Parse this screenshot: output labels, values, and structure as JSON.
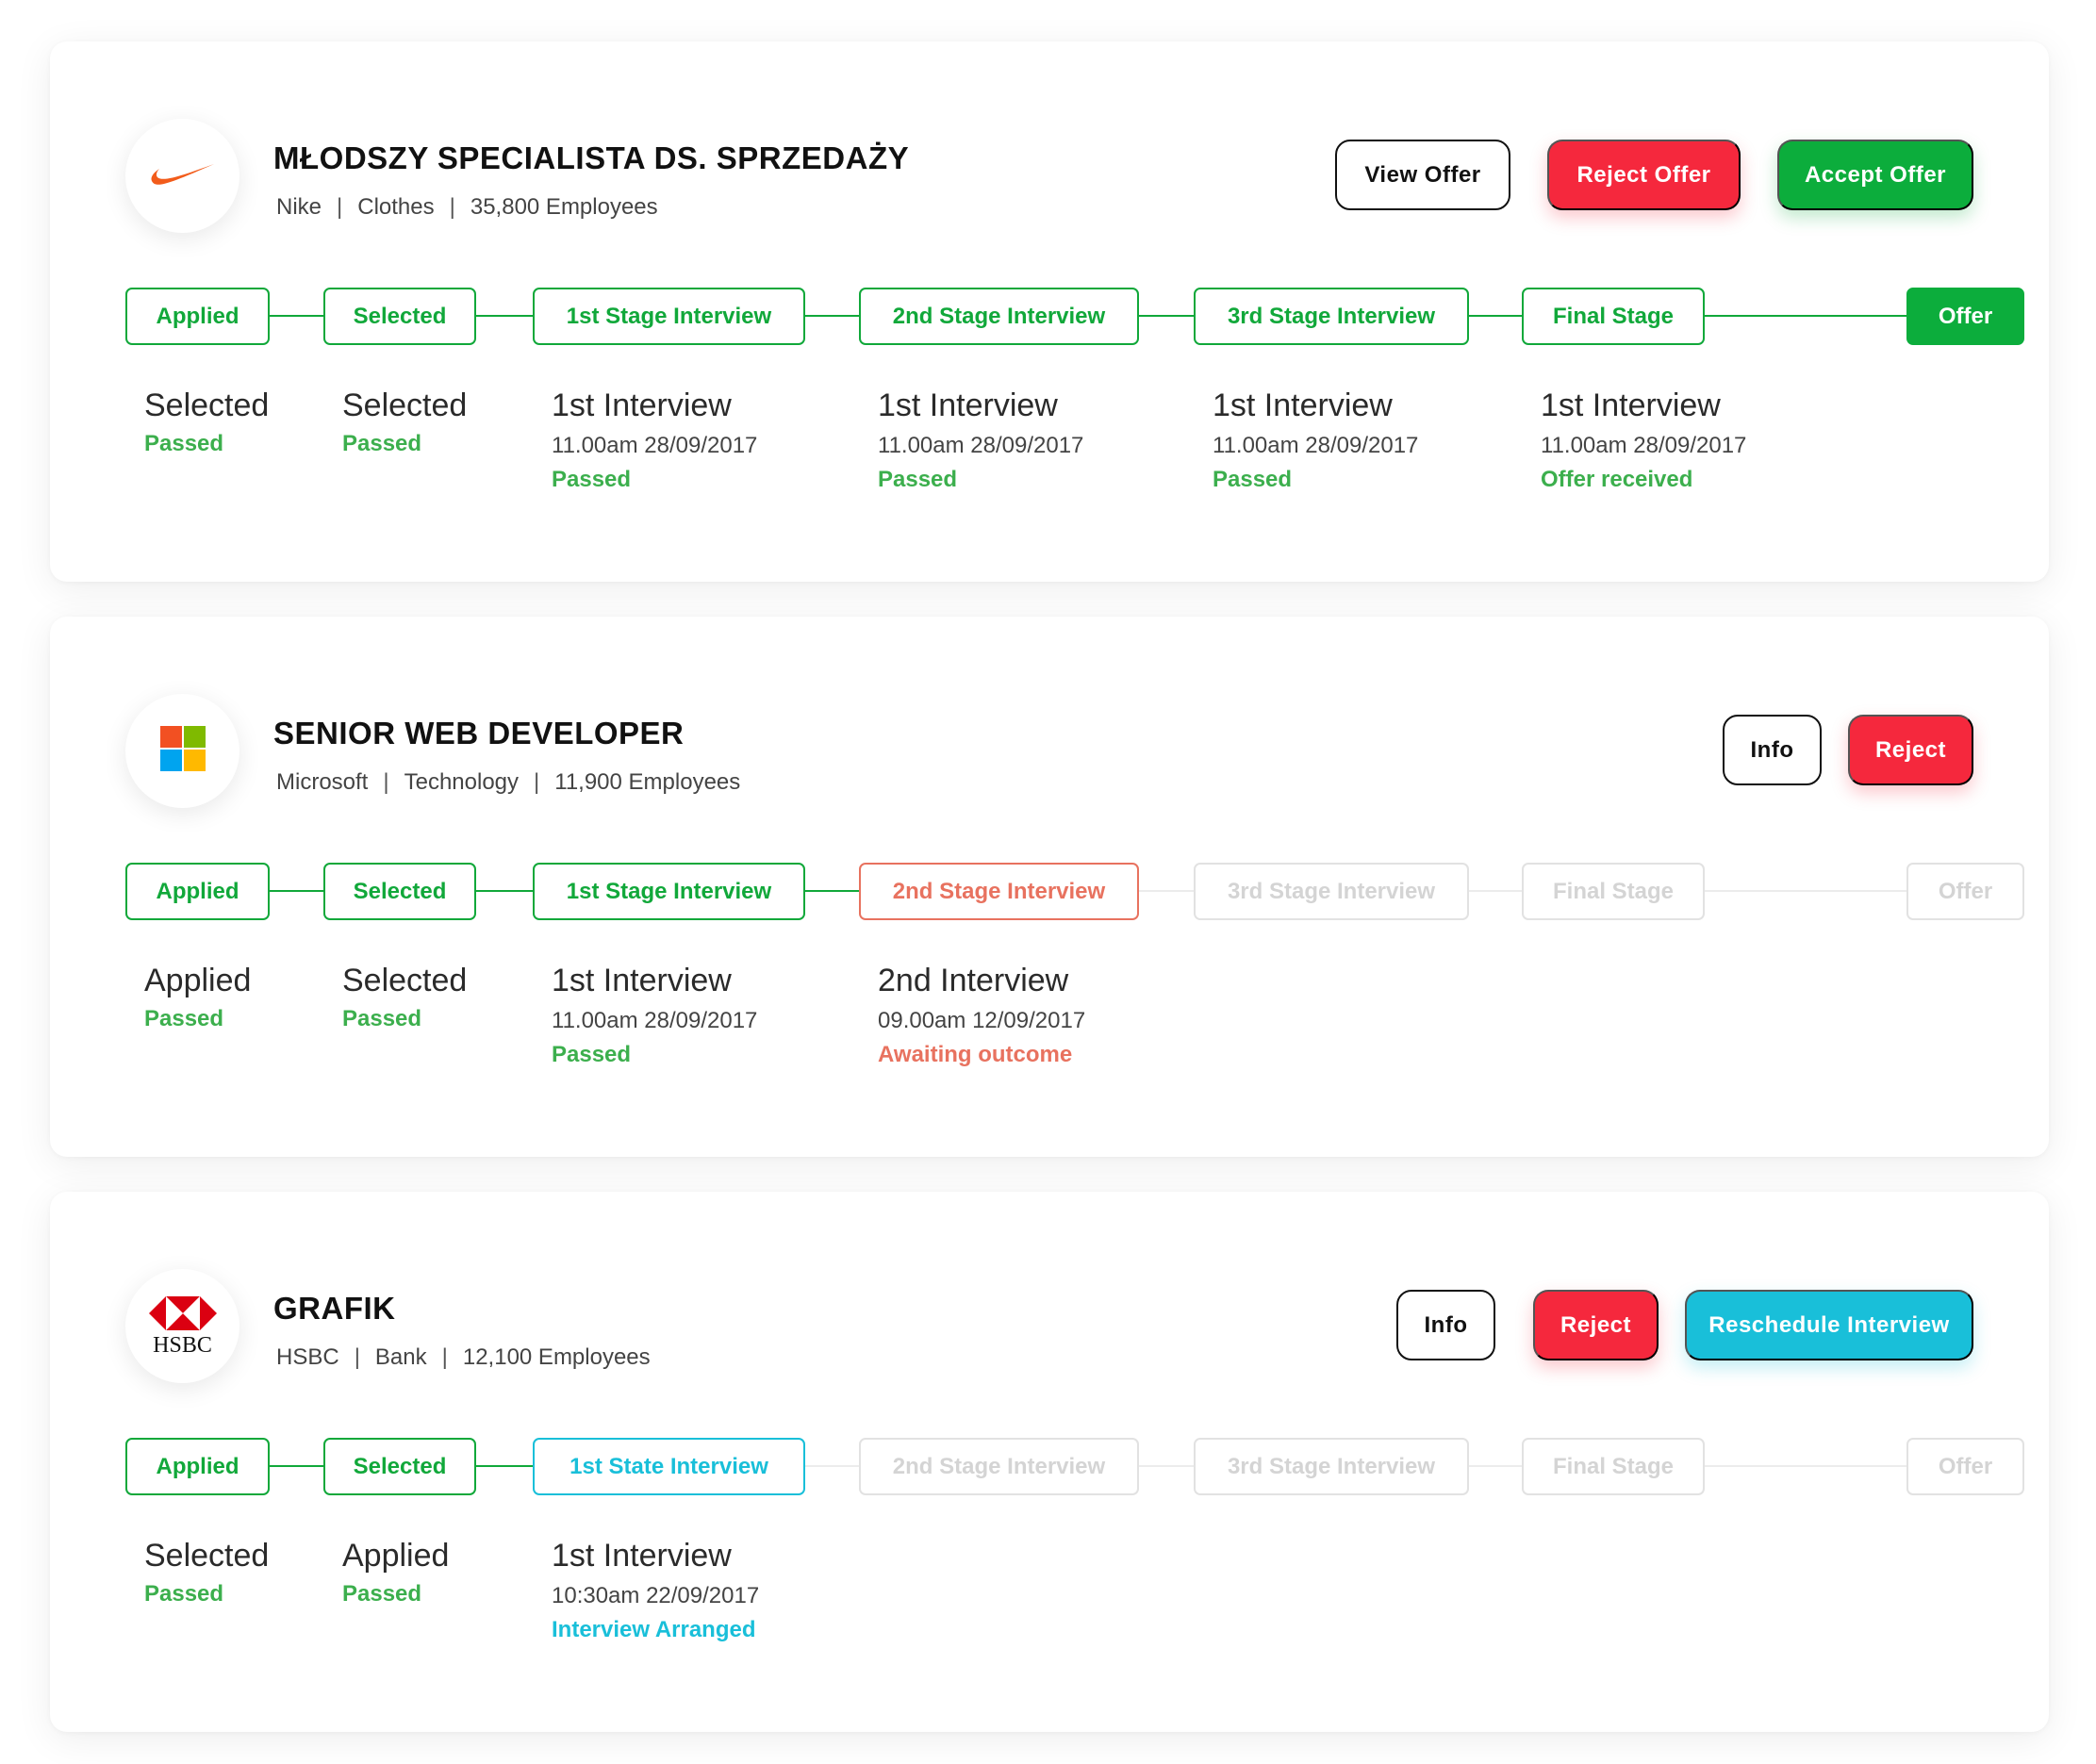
{
  "jobs": [
    {
      "title": "MŁODSZY SPECIALISTA DS. SPRZEDAŻY",
      "company": "Nike",
      "industry": "Clothes",
      "employees": "35,800 Employees",
      "logo_icon": "nike-swoosh-icon",
      "actions": [
        {
          "label": "View Offer",
          "style": "outline"
        },
        {
          "label": "Reject Offer",
          "style": "red"
        },
        {
          "label": "Accept Offer",
          "style": "green"
        }
      ],
      "stages": [
        {
          "label": "Applied",
          "state": "done"
        },
        {
          "label": "Selected",
          "state": "done"
        },
        {
          "label": "1st Stage Interview",
          "state": "done"
        },
        {
          "label": "2nd Stage Interview",
          "state": "done"
        },
        {
          "label": "3rd Stage Interview",
          "state": "done"
        },
        {
          "label": "Final Stage",
          "state": "done"
        },
        {
          "label": "Offer",
          "state": "filled"
        }
      ],
      "details": [
        {
          "heading": "Selected",
          "status": "Passed",
          "status_type": "pass"
        },
        {
          "heading": "Selected",
          "status": "Passed",
          "status_type": "pass"
        },
        {
          "heading": "1st Interview",
          "time": "11.00am 28/09/2017",
          "status": "Passed",
          "status_type": "pass"
        },
        {
          "heading": "1st Interview",
          "time": "11.00am 28/09/2017",
          "status": "Passed",
          "status_type": "pass"
        },
        {
          "heading": "1st Interview",
          "time": "11.00am 28/09/2017",
          "status": "Passed",
          "status_type": "pass"
        },
        {
          "heading": "1st Interview",
          "time": "11.00am 28/09/2017",
          "status": "Offer received",
          "status_type": "pass"
        }
      ]
    },
    {
      "title": "SENIOR WEB DEVELOPER",
      "company": "Microsoft",
      "industry": "Technology",
      "employees": "11,900 Employees",
      "logo_icon": "microsoft-logo-icon",
      "actions": [
        {
          "label": "Info",
          "style": "outline"
        },
        {
          "label": "Reject",
          "style": "red"
        }
      ],
      "stages": [
        {
          "label": "Applied",
          "state": "done"
        },
        {
          "label": "Selected",
          "state": "done"
        },
        {
          "label": "1st Stage Interview",
          "state": "done"
        },
        {
          "label": "2nd Stage Interview",
          "state": "pending"
        },
        {
          "label": "3rd Stage Interview",
          "state": "off"
        },
        {
          "label": "Final Stage",
          "state": "off"
        },
        {
          "label": "Offer",
          "state": "off"
        }
      ],
      "details": [
        {
          "heading": "Applied",
          "status": "Passed",
          "status_type": "pass"
        },
        {
          "heading": "Selected",
          "status": "Passed",
          "status_type": "pass"
        },
        {
          "heading": "1st Interview",
          "time": "11.00am 28/09/2017",
          "status": "Passed",
          "status_type": "pass"
        },
        {
          "heading": "2nd Interview",
          "time": "09.00am 12/09/2017",
          "status": "Awaiting outcome",
          "status_type": "pending"
        }
      ]
    },
    {
      "title": "GRAFIK",
      "company": "HSBC",
      "industry": "Bank",
      "employees": "12,100 Employees",
      "logo_icon": "hsbc-logo-icon",
      "logo_text": "HSBC",
      "actions": [
        {
          "label": "Info",
          "style": "outline"
        },
        {
          "label": "Reject",
          "style": "red"
        },
        {
          "label": "Reschedule Interview",
          "style": "cyan"
        }
      ],
      "stages": [
        {
          "label": "Applied",
          "state": "done"
        },
        {
          "label": "Selected",
          "state": "done"
        },
        {
          "label": "1st State Interview",
          "state": "current"
        },
        {
          "label": "2nd Stage Interview",
          "state": "off"
        },
        {
          "label": "3rd Stage Interview",
          "state": "off"
        },
        {
          "label": "Final Stage",
          "state": "off"
        },
        {
          "label": "Offer",
          "state": "off"
        }
      ],
      "details": [
        {
          "heading": "Selected",
          "status": "Passed",
          "status_type": "pass"
        },
        {
          "heading": "Applied",
          "status": "Passed",
          "status_type": "pass"
        },
        {
          "heading": "1st Interview",
          "time": "10:30am 22/09/2017",
          "status": "Interview Arranged",
          "status_type": "current"
        }
      ]
    }
  ],
  "colors": {
    "green": "#0cad3c",
    "red": "#f5283d",
    "cyan": "#19bfd9",
    "salmon": "#e8725f",
    "disabled": "#e2e2e2"
  }
}
